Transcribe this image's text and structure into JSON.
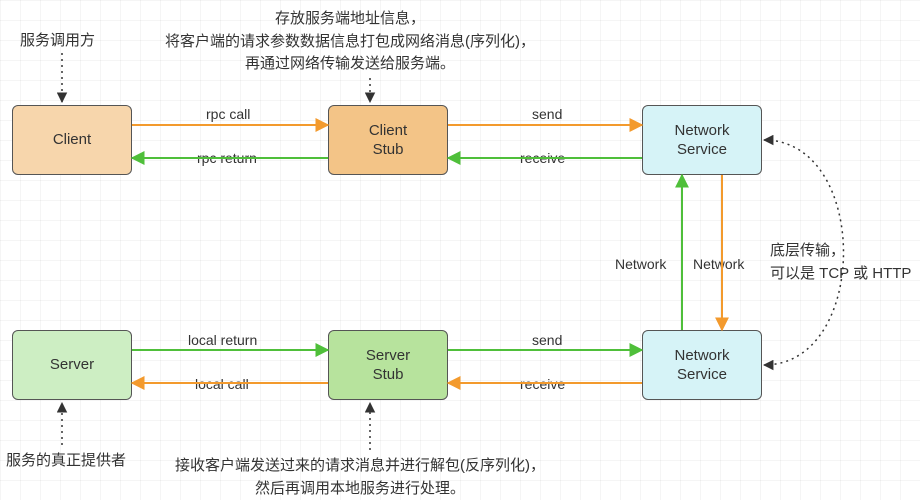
{
  "nodes": {
    "client": {
      "label": "Client"
    },
    "client_stub": {
      "label": "Client\nStub"
    },
    "net_top": {
      "label": "Network\nService"
    },
    "server": {
      "label": "Server"
    },
    "server_stub": {
      "label": "Server\nStub"
    },
    "net_bottom": {
      "label": "Network\nService"
    }
  },
  "notes": {
    "caller": "服务调用方",
    "client_stub": "存放服务端地址信息，\n将客户端的请求参数数据信息打包成网络消息(序列化)，\n再通过网络传输发送给服务端。",
    "transport": "底层传输，\n可以是 TCP 或 HTTP",
    "provider": "服务的真正提供者",
    "server_stub": "接收客户端发送过来的请求消息并进行解包(反序列化)，\n然后再调用本地服务进行处理。"
  },
  "edges": {
    "rpc_call": "rpc call",
    "rpc_return": "rpc return",
    "send_top": "send",
    "recv_top": "receive",
    "net_down": "Network",
    "net_up": "Network",
    "send_bot": "send",
    "recv_bot": "receive",
    "local_ret": "local return",
    "local_call": "local call"
  },
  "colors": {
    "orange": "#f39a2d",
    "green": "#4fbf3a"
  }
}
